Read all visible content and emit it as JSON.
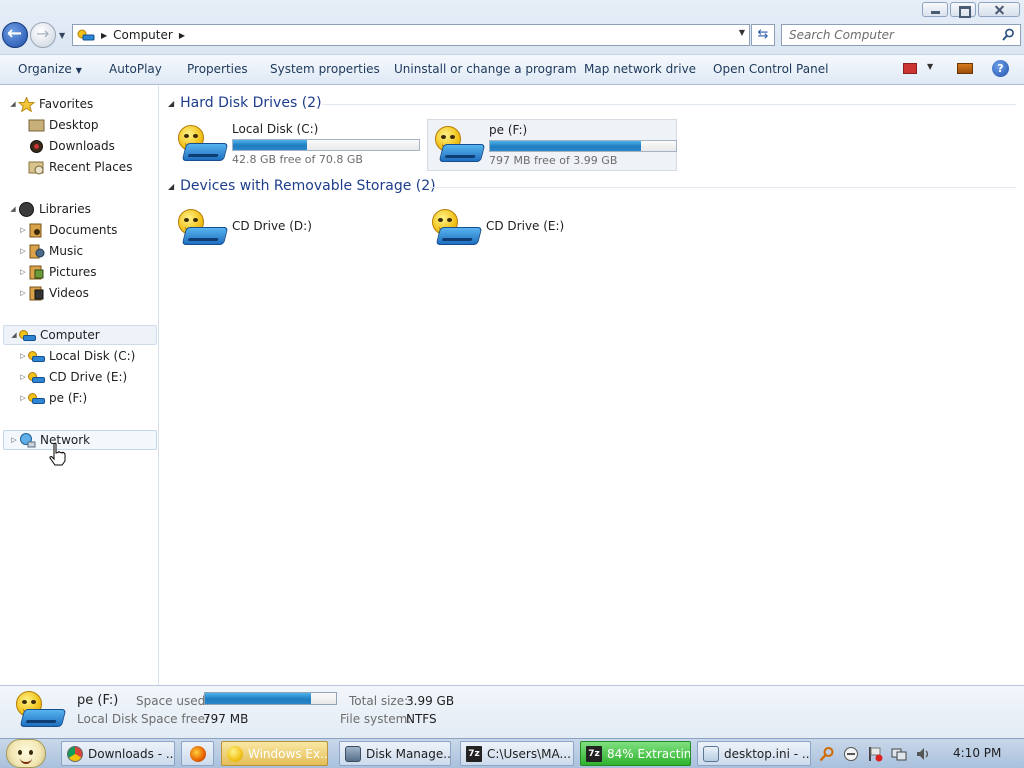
{
  "window": {
    "address": {
      "crumb": "Computer"
    },
    "search": {
      "placeholder": "Search Computer"
    }
  },
  "commandbar": {
    "organize": "Organize",
    "autoplay": "AutoPlay",
    "properties": "Properties",
    "system_properties": "System properties",
    "uninstall": "Uninstall or change a program",
    "map_network": "Map network drive",
    "control_panel": "Open Control Panel"
  },
  "sidebar": {
    "favorites": "Favorites",
    "desktop": "Desktop",
    "downloads": "Downloads",
    "recent_places": "Recent Places",
    "libraries": "Libraries",
    "documents": "Documents",
    "music": "Music",
    "pictures": "Pictures",
    "videos": "Videos",
    "computer": "Computer",
    "local_disk": "Local Disk (C:)",
    "cd_drive_e": "CD Drive (E:)",
    "pe_f": "pe (F:)",
    "network": "Network"
  },
  "main": {
    "hard_disk_header": "Hard Disk Drives (2)",
    "removable_header": "Devices with Removable Storage (2)",
    "drives": [
      {
        "name": "Local Disk (C:)",
        "free": "42.8 GB free of 70.8 GB",
        "used_fraction": 0.4
      },
      {
        "name": "pe (F:)",
        "free": "797 MB free of 3.99 GB",
        "used_fraction": 0.81
      }
    ],
    "removable": [
      {
        "name": "CD Drive (D:)"
      },
      {
        "name": "CD Drive (E:)"
      }
    ]
  },
  "details": {
    "name": "pe (F:)",
    "type": "Local Disk",
    "space_used_label": "Space used:",
    "space_free_label": "Space free:",
    "space_free_value": "797 MB",
    "total_size_label": "Total size:",
    "total_size_value": "3.99 GB",
    "file_system_label": "File system:",
    "file_system_value": "NTFS",
    "used_fraction": 0.81
  },
  "taskbar": {
    "tasks": [
      "Downloads - ...",
      "Windows Ex...",
      "Disk Manage...",
      "C:\\Users\\MA...",
      "84% Extractin...",
      "desktop.ini - ..."
    ],
    "clock": "4:10 PM"
  },
  "colors": {
    "accent": "#1f7dc0",
    "header_blue": "#1e3e8c"
  }
}
